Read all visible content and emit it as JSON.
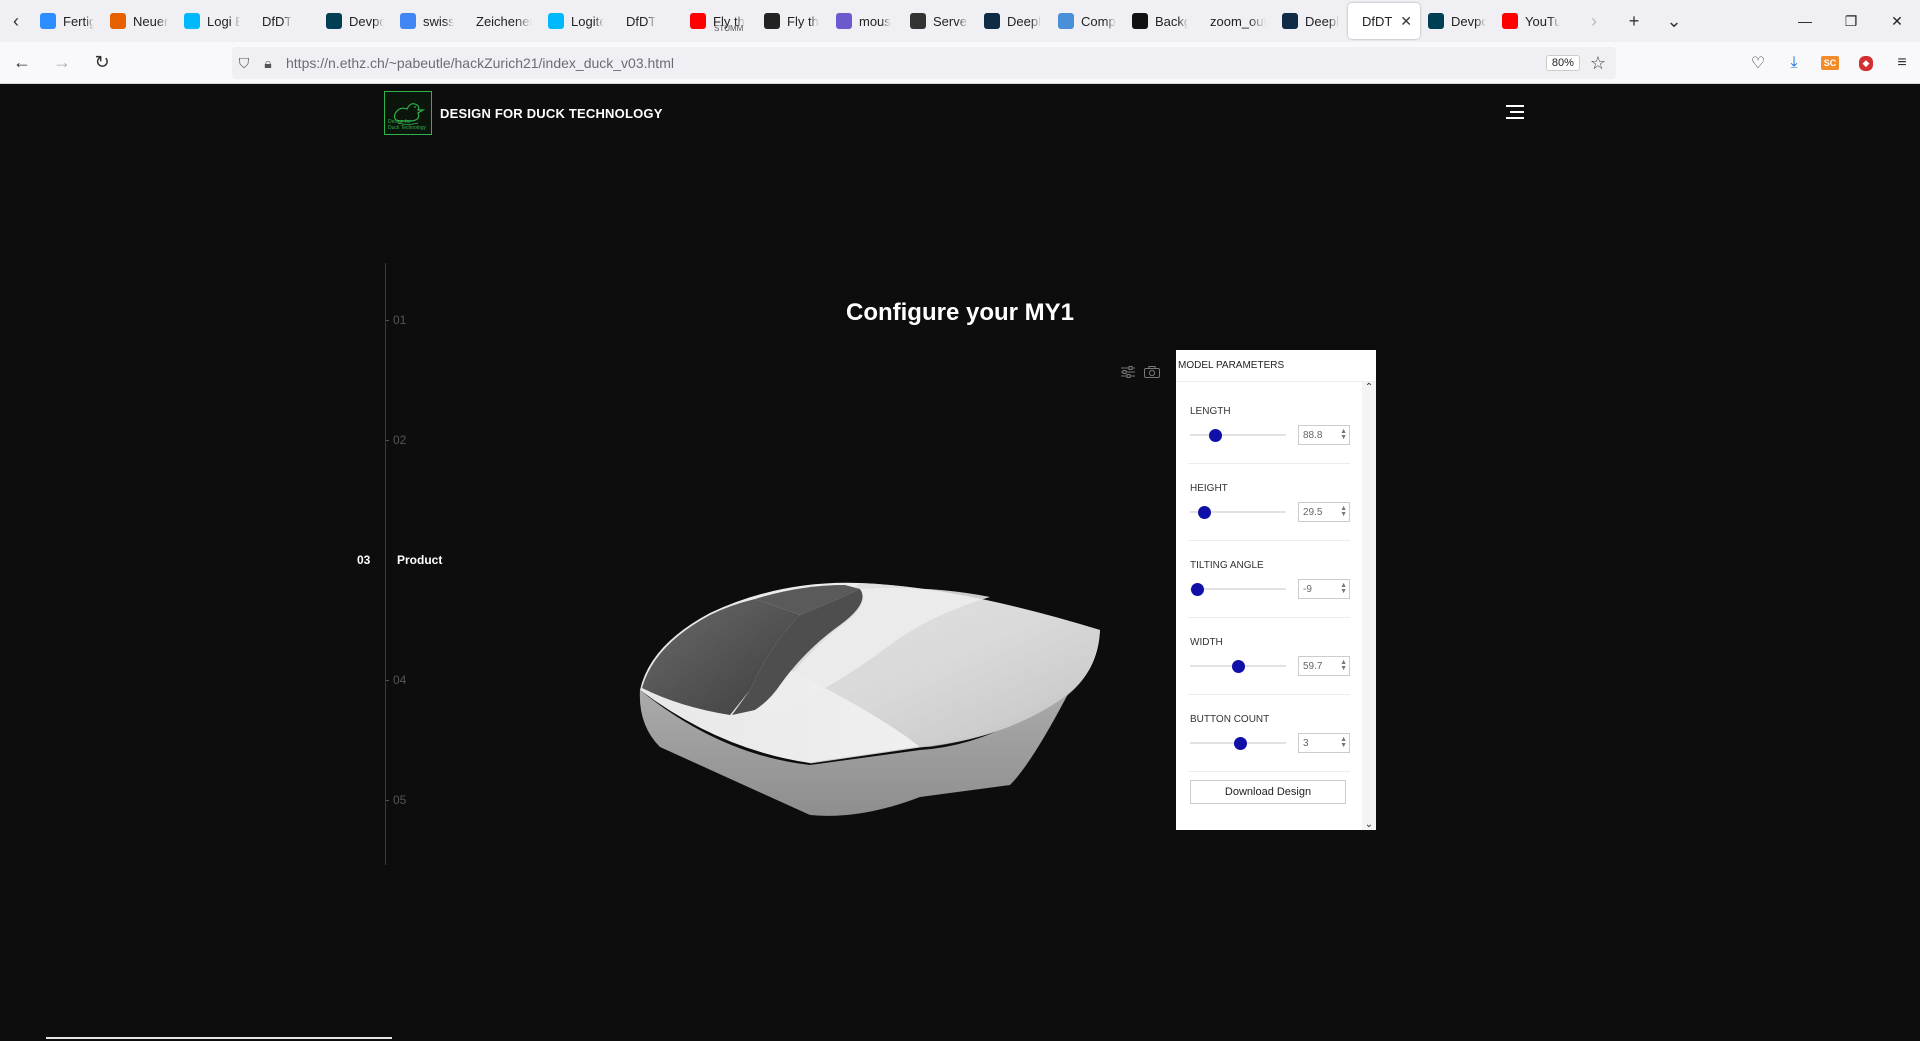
{
  "browser": {
    "tabs": [
      {
        "label": "Fertig",
        "favicon": "zoom-icon",
        "color": "#2d8cff"
      },
      {
        "label": "Neuer",
        "favicon": "firefox-icon",
        "color": "#e66000"
      },
      {
        "label": "Logi B",
        "favicon": "logi-icon",
        "color": "#00b8fc"
      },
      {
        "label": "DfDT",
        "favicon": "blank-icon",
        "color": ""
      },
      {
        "label": "Devpo",
        "favicon": "devpost-icon",
        "color": "#003e54"
      },
      {
        "label": "swiss",
        "favicon": "google-icon",
        "color": "#4285f4"
      },
      {
        "label": "Zeichener",
        "favicon": "blank-icon",
        "color": ""
      },
      {
        "label": "Logite",
        "favicon": "logi-icon",
        "color": "#00b8fc"
      },
      {
        "label": "DfDT",
        "favicon": "blank-icon",
        "color": ""
      },
      {
        "label": "Fly th",
        "sub": "STUMM",
        "favicon": "youtube-icon",
        "color": "#ff0000"
      },
      {
        "label": "Fly th",
        "favicon": "dark-icon",
        "color": "#222222"
      },
      {
        "label": "mous",
        "favicon": "wave-icon",
        "color": "#6a5acd"
      },
      {
        "label": "Server",
        "favicon": "info-icon",
        "color": "#333333"
      },
      {
        "label": "Deepl",
        "favicon": "deepl-icon",
        "color": "#0f2b46"
      },
      {
        "label": "Comp",
        "favicon": "wave-icon",
        "color": "#4a90d9"
      },
      {
        "label": "Backg",
        "favicon": "github-icon",
        "color": "#111111"
      },
      {
        "label": "zoom_out",
        "favicon": "blank-icon",
        "color": ""
      },
      {
        "label": "Deepl",
        "favicon": "deepl-icon",
        "color": "#0f2b46"
      },
      {
        "label": "DfDT",
        "favicon": "blank-icon",
        "color": "",
        "active": true
      },
      {
        "label": "Devpo",
        "favicon": "devpost-icon",
        "color": "#003e54"
      },
      {
        "label": "YouTu",
        "favicon": "youtube-icon",
        "color": "#ff0000"
      }
    ],
    "url": "https://n.ethz.ch/~pabeutle/hackZurich21/index_duck_v03.html",
    "zoom": "80%"
  },
  "header": {
    "brand": "DESIGN FOR DUCK TECHNOLOGY",
    "logo_text": "Design for Duck Technology",
    "logo_color": "#2fb34a"
  },
  "steps": {
    "items": [
      "01",
      "02",
      "03",
      "04",
      "05"
    ],
    "active_index": 2,
    "active_label": "Product"
  },
  "title": "Configure your MY1",
  "params": {
    "title": "MODEL PARAMETERS",
    "items": [
      {
        "label": "LENGTH",
        "value": "88.8",
        "level": 0.26
      },
      {
        "label": "HEIGHT",
        "value": "29.5",
        "level": 0.15
      },
      {
        "label": "TILTING ANGLE",
        "value": "-9",
        "level": 0.07
      },
      {
        "label": "WIDTH",
        "value": "59.7",
        "level": 0.5
      },
      {
        "label": "BUTTON COUNT",
        "value": "3",
        "level": 0.52
      }
    ],
    "download_label": "Download Design",
    "thumb_color": "#1010a8"
  }
}
